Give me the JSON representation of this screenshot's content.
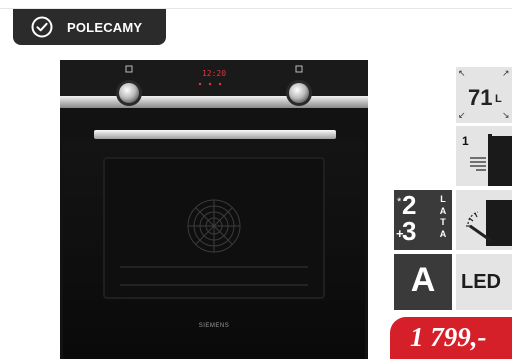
{
  "badge": {
    "label": "POLECAMY",
    "icon": "check-circle-icon"
  },
  "oven": {
    "brand": "SIEMENS",
    "display": "12:20"
  },
  "specs": {
    "capacity": {
      "value": "71",
      "unit": "L",
      "icon": "expand-arrows-icon"
    },
    "levels": {
      "value": "1",
      "icon": "oven-levels-icon"
    },
    "warranty": {
      "star": "*",
      "base": "2",
      "plus": "+",
      "extra": "3",
      "word": [
        "L",
        "A",
        "T",
        "A"
      ]
    },
    "timer": {
      "icon": "timer-dial-icon"
    },
    "energy_class": {
      "value": "A"
    },
    "lighting": {
      "value": "LED"
    }
  },
  "price": {
    "value": "1 799,-",
    "color": "#d5202a"
  },
  "colors": {
    "badge": "#2b2b2b",
    "tile_light": "#e4e4e4",
    "tile_dark": "#3a3a3a"
  }
}
